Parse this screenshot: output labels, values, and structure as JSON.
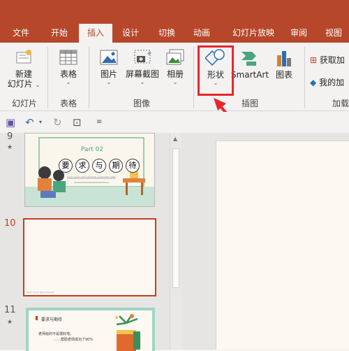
{
  "tabs": [
    "文件",
    "开始",
    "插入",
    "设计",
    "切换",
    "动画",
    "幻灯片放映",
    "审阅",
    "视图"
  ],
  "active_tab": "插入",
  "ribbon": {
    "new_slide_l1": "新建",
    "new_slide_l2": "幻灯片",
    "new_slide_chev": "⌄",
    "slides_group": "幻灯片",
    "table": "表格",
    "tables_group": "表格",
    "pictures": "图片",
    "screenshot": "屏幕截图",
    "album": "相册",
    "images_group": "图像",
    "shapes": "形状",
    "smartart": "SmartArt",
    "chart": "图表",
    "illustrations_group": "插图",
    "get_addins": "获取加",
    "my_addins": "我的加",
    "addins_group": "加载"
  },
  "slides": [
    {
      "number": "9",
      "title_en": "Part 02",
      "title_chars": [
        "要",
        "求",
        "与",
        "期",
        "待"
      ],
      "caption": "Lorem ipsum dolor sit amet, consectetur adipiscing"
    },
    {
      "number": "10",
      "footer": "2021 Lorem Ipsum Design"
    },
    {
      "number": "11",
      "heading": "要求与期待",
      "text1": "老师给的不是很好地。",
      "text2": "……帮助老师成功了90%"
    }
  ],
  "colors": {
    "accent": "#b7472a",
    "highlight": "#e8262b",
    "selected_border": "#c43e1c",
    "slide_green": "#4fae8e"
  }
}
